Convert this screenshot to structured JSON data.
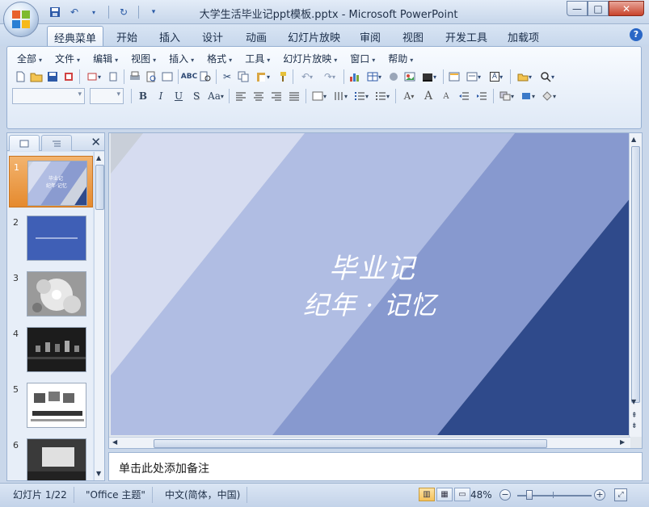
{
  "window": {
    "title": "大学生活毕业记ppt模板.pptx - Microsoft PowerPoint",
    "min_label": "—",
    "max_label": "□",
    "close_label": "✕"
  },
  "qat": {
    "save_icon": "💾",
    "undo_icon": "↶",
    "redo_icon": "↻",
    "customize_icon": "▾"
  },
  "ribbon": {
    "tabs": [
      "经典菜单",
      "开始",
      "插入",
      "设计",
      "动画",
      "幻灯片放映",
      "审阅",
      "视图",
      "开发工具",
      "加载项"
    ],
    "active_tab": "经典菜单",
    "help": "?"
  },
  "menus": [
    "全部",
    "文件",
    "编辑",
    "视图",
    "插入",
    "格式",
    "工具",
    "幻灯片放映",
    "窗口",
    "帮助"
  ],
  "toolbar": {
    "format_buttons": {
      "bold": "B",
      "italic": "I",
      "underline": "U",
      "shadow": "S",
      "case": "Aa",
      "font_grow": "A",
      "font_shrink": "A"
    }
  },
  "left_pane": {
    "close": "✕",
    "slides": [
      "1",
      "2",
      "3",
      "4",
      "5",
      "6"
    ],
    "selected_slide": "1",
    "slide1_thumb_text": [
      "毕业记",
      "纪年·记忆"
    ]
  },
  "slide": {
    "title": "毕业记",
    "subtitle": "纪年 · 记忆",
    "colors": {
      "lightest": "#d6dcf0",
      "light": "#b0bde3",
      "medium": "#8799cf",
      "dark": "#2f4a8b",
      "gray": "#c9cfd9"
    }
  },
  "notes": {
    "placeholder": "单击此处添加备注"
  },
  "statusbar": {
    "slide_counter": "幻灯片 1/22",
    "theme": "\"Office 主题\"",
    "language": "中文(简体，中国)",
    "zoom": "48%",
    "zoom_minus": "−",
    "zoom_plus": "+"
  }
}
